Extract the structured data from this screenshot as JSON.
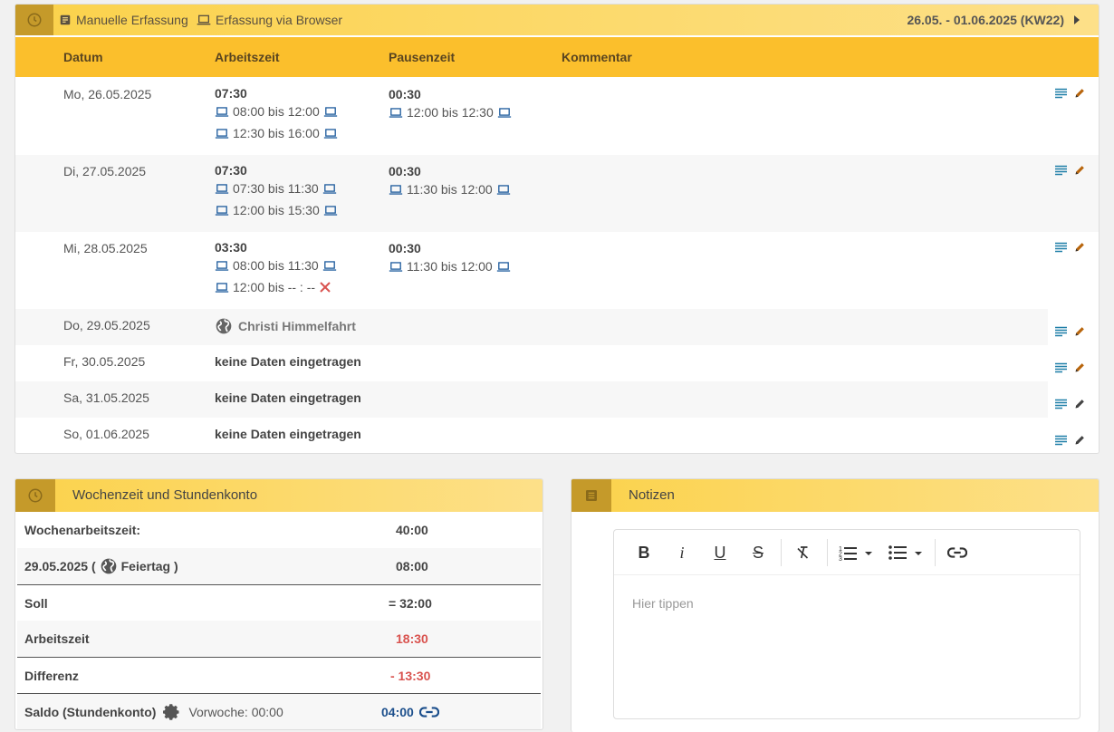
{
  "header": {
    "legend_manual": "Manuelle Erfassung",
    "legend_browser": "Erfassung via Browser",
    "week_range": "26.05. - 01.06.2025 (KW22)"
  },
  "columns": {
    "datum": "Datum",
    "arbeitszeit": "Arbeitszeit",
    "pausenzeit": "Pausenzeit",
    "kommentar": "Kommentar"
  },
  "days": [
    {
      "date": "Mo, 26.05.2025",
      "work_total": "07:30",
      "work_intervals": [
        "08:00 bis 12:00",
        "12:30 bis 16:00"
      ],
      "pause_total": "00:30",
      "pause_intervals": [
        "12:00 bis 12:30"
      ]
    },
    {
      "date": "Di, 27.05.2025",
      "work_total": "07:30",
      "work_intervals": [
        "07:30 bis 11:30",
        "12:00 bis 15:30"
      ],
      "pause_total": "00:30",
      "pause_intervals": [
        "11:30 bis 12:00"
      ]
    },
    {
      "date": "Mi, 28.05.2025",
      "work_total": "03:30",
      "work_intervals": [
        "08:00 bis 11:30",
        "12:00 bis -- : --"
      ],
      "pause_total": "00:30",
      "pause_intervals": [
        "11:30 bis 12:00"
      ]
    },
    {
      "date": "Do, 29.05.2025",
      "holiday": "Christi Himmelfahrt"
    },
    {
      "date": "Fr, 30.05.2025",
      "note": "keine Daten eingetragen"
    },
    {
      "date": "Sa, 31.05.2025",
      "note": "keine Daten eingetragen"
    },
    {
      "date": "So, 01.06.2025",
      "note": "keine Daten eingetragen"
    }
  ],
  "konto": {
    "title": "Wochenzeit und Stundenkonto",
    "rows": [
      {
        "label": "Wochenarbeitszeit:",
        "value": "40:00"
      },
      {
        "label_date": "29.05.2025 (",
        "label_feiertag": "Feiertag )",
        "value": "08:00"
      },
      {
        "label": "Soll",
        "value": "= 32:00"
      },
      {
        "label": "Arbeitszeit",
        "value": "18:30"
      },
      {
        "label": "Differenz",
        "value": "- 13:30"
      },
      {
        "label": "Saldo (Stundenkonto)",
        "sub": "Vorwoche: 00:00",
        "value": "04:00"
      }
    ]
  },
  "notes": {
    "title": "Notizen",
    "placeholder": "Hier tippen",
    "tools": [
      "B",
      "i",
      "U",
      "S"
    ]
  },
  "colors": {
    "amber": "#fbbf2c",
    "header_gold": "#fbd24b",
    "icon_box": "#c59a2a",
    "blue_icon": "#1c5a9c",
    "red": "#d9534f",
    "link_blue": "#1c4f8c"
  }
}
